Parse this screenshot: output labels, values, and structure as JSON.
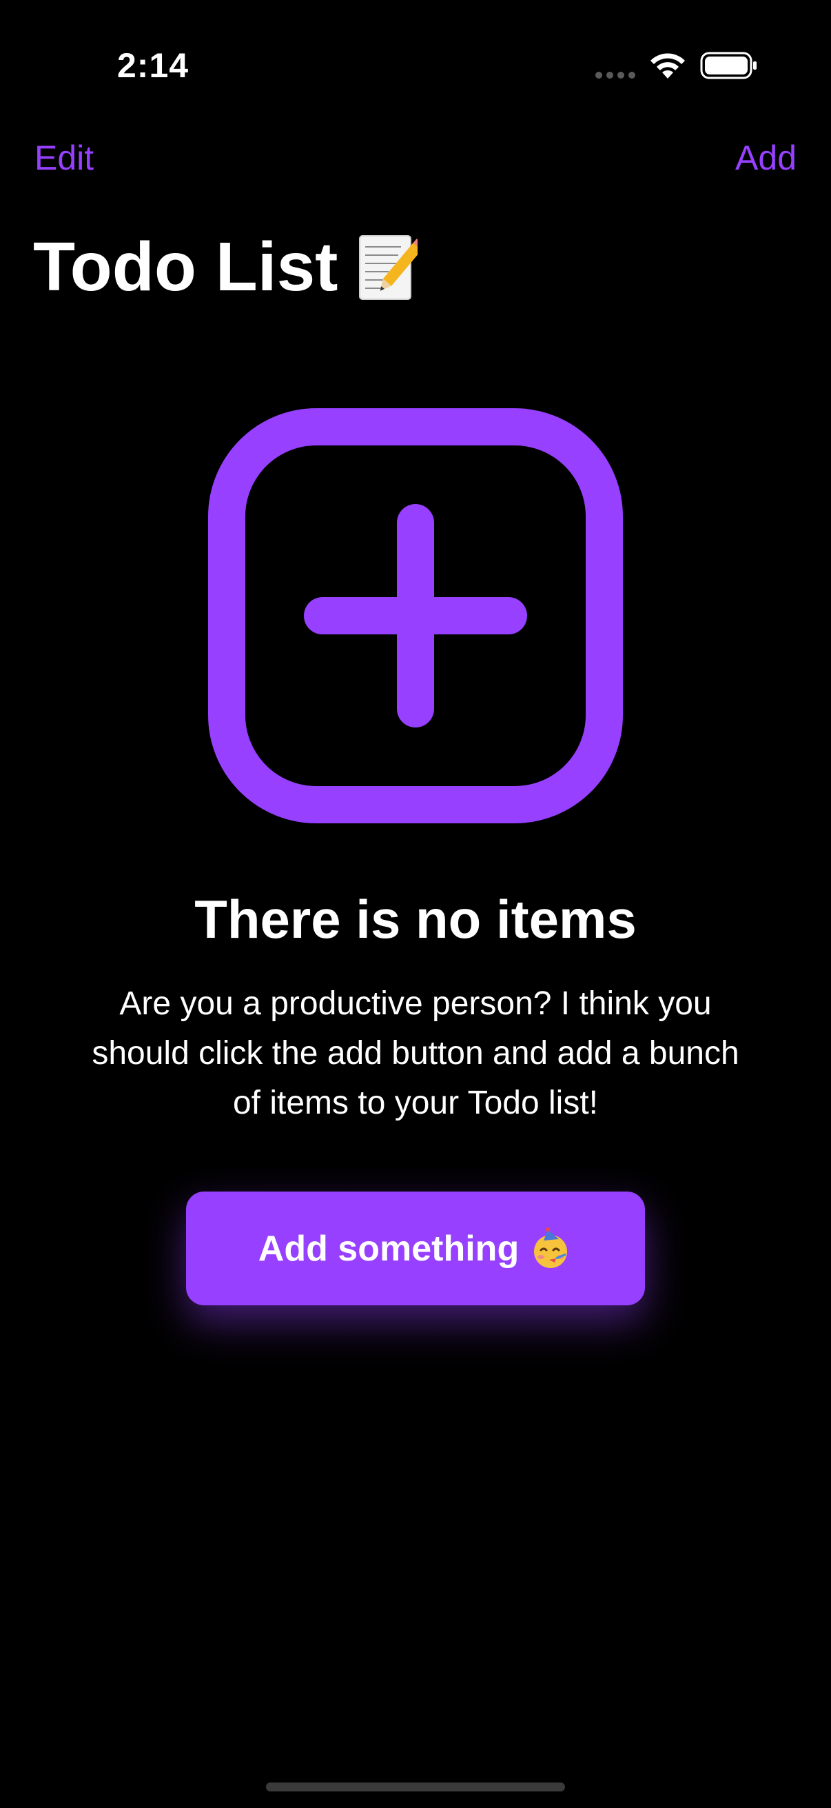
{
  "status_bar": {
    "time": "2:14",
    "icons": [
      "cellular-signal-icon",
      "wifi-icon",
      "battery-icon"
    ]
  },
  "nav": {
    "edit_label": "Edit",
    "add_label": "Add"
  },
  "page": {
    "title": "Todo List",
    "title_icon": "memo-emoji-icon"
  },
  "empty_state": {
    "icon": "plus-square-icon",
    "title": "There is no items",
    "description": "Are you a productive person? I think you should click the add button and add a bunch of items to your Todo list!",
    "button_label": "Add something",
    "button_icon": "party-face-emoji-icon"
  },
  "colors": {
    "accent": "#9740ff",
    "background": "#000000",
    "text": "#ffffff"
  }
}
